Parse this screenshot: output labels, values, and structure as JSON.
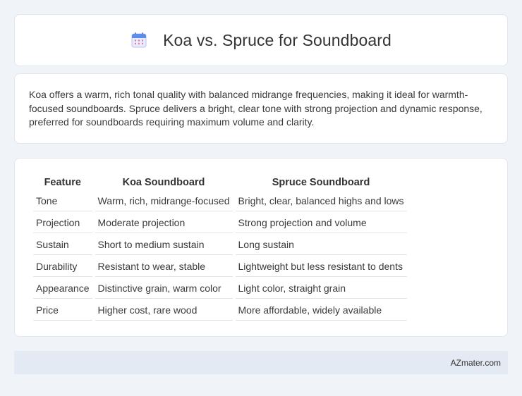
{
  "header": {
    "title": "Koa vs. Spruce for Soundboard",
    "icon": "calendar-icon"
  },
  "intro": {
    "text": "Koa offers a warm, rich tonal quality with balanced midrange frequencies, making it ideal for warmth-focused soundboards. Spruce delivers a bright, clear tone with strong projection and dynamic response, preferred for soundboards requiring maximum volume and clarity."
  },
  "table": {
    "headers": [
      "Feature",
      "Koa Soundboard",
      "Spruce Soundboard"
    ],
    "rows": [
      [
        "Tone",
        "Warm, rich, midrange-focused",
        "Bright, clear, balanced highs and lows"
      ],
      [
        "Projection",
        "Moderate projection",
        "Strong projection and volume"
      ],
      [
        "Sustain",
        "Short to medium sustain",
        "Long sustain"
      ],
      [
        "Durability",
        "Resistant to wear, stable",
        "Lightweight but less resistant to dents"
      ],
      [
        "Appearance",
        "Distinctive grain, warm color",
        "Light color, straight grain"
      ],
      [
        "Price",
        "Higher cost, rare wood",
        "More affordable, widely available"
      ]
    ]
  },
  "footer": {
    "site": "AZmater.com"
  }
}
